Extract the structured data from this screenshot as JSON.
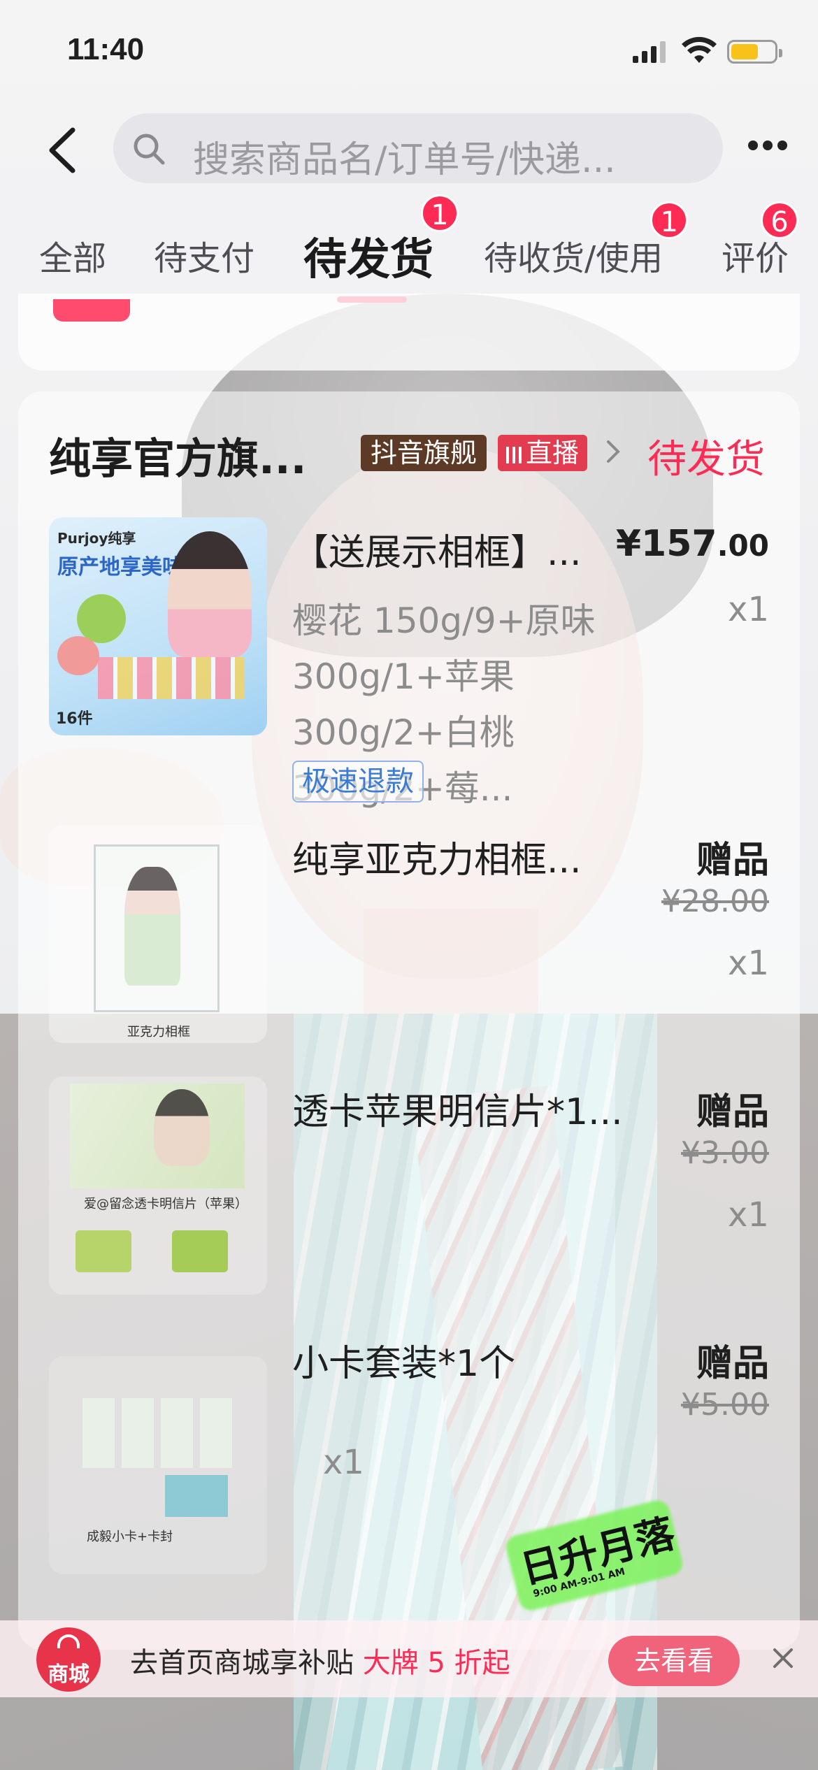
{
  "status_bar": {
    "time": "11:40"
  },
  "search": {
    "placeholder": "搜索商品名/订单号/快递..."
  },
  "tabs": [
    {
      "label": "全部"
    },
    {
      "label": "待支付"
    },
    {
      "label": "待发货",
      "badge": "1",
      "active": true
    },
    {
      "label": "待收货/使用",
      "badge": "1"
    },
    {
      "label": "评价",
      "badge": "6"
    }
  ],
  "order": {
    "shop_name": "纯享官方旗...",
    "tag_flagship": "抖音旗舰",
    "tag_live": "直播",
    "status": "待发货",
    "items": [
      {
        "name": "【送展示相框】...",
        "price_main": "¥157",
        "price_decimal": ".00",
        "spec": "樱花 150g/9+原味 300g/1+苹果 300g/2+白桃 300g/2+莓...",
        "qty": "x1",
        "refund_tag": "极速退款",
        "thumb": {
          "brand": "Purjoy纯享",
          "slogan": "原产地享美味",
          "count": "16件"
        }
      },
      {
        "name": "纯享亚克力相框...",
        "gift": "赠品",
        "orig_price": "¥28.00",
        "qty": "x1",
        "thumb": {
          "label": "亚克力相框"
        }
      },
      {
        "name": "透卡苹果明信片*1...",
        "gift": "赠品",
        "orig_price": "¥3.00",
        "qty": "x1",
        "thumb": {
          "label": "爱@留念透卡明信片（苹果）"
        }
      },
      {
        "name": "小卡套装*1个",
        "gift": "赠品",
        "orig_price": "¥5.00",
        "qty": "x1",
        "thumb": {
          "label": "成毅小卡+卡封"
        }
      }
    ]
  },
  "sticker": {
    "text": "日升月落",
    "sub": "9:00 AM-9:01 AM"
  },
  "banner": {
    "mall_label": "商城",
    "text": "去首页商城享补贴",
    "highlight": "大牌 5 折起",
    "cta": "去看看"
  },
  "colors": {
    "accent": "#fe2c55",
    "refund_blue": "#3a7bd5",
    "flagship_brown": "#5d3a26"
  }
}
